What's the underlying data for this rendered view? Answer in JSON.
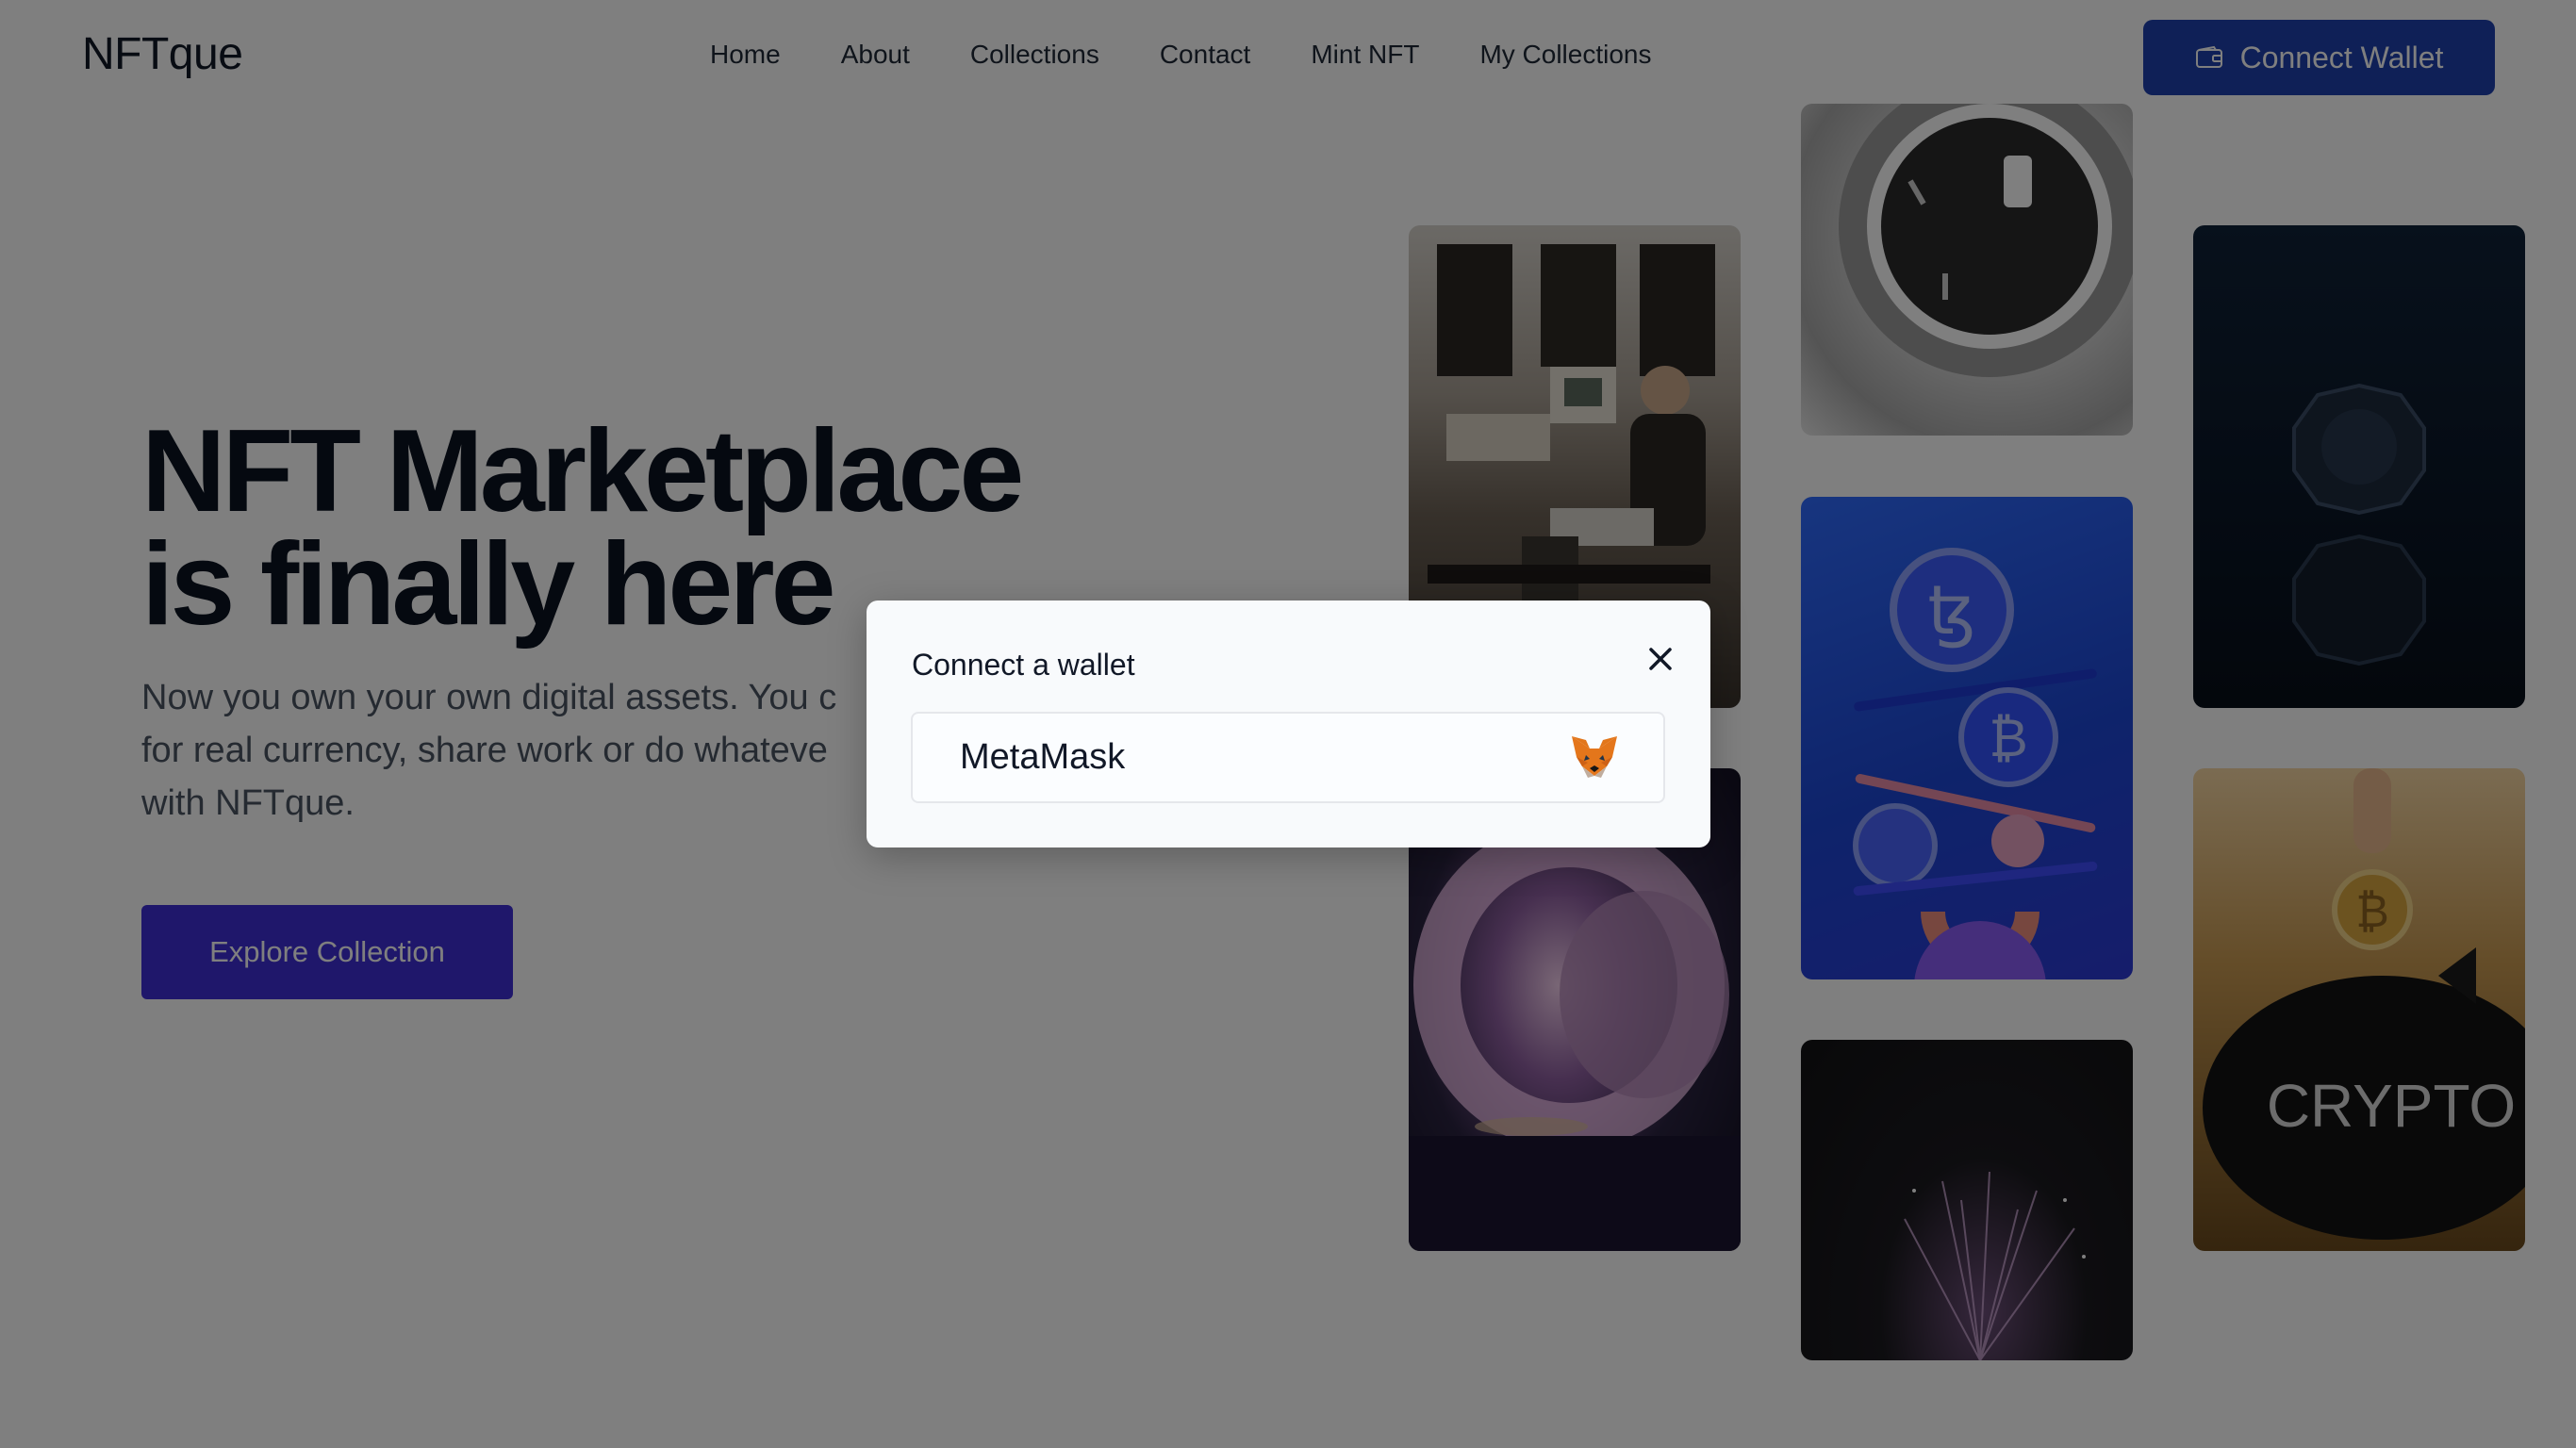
{
  "nav": {
    "brand": "NFTque",
    "links": [
      "Home",
      "About",
      "Collections",
      "Contact",
      "Mint NFT",
      "My Collections"
    ],
    "connect_label": "Connect Wallet"
  },
  "hero": {
    "title_line1": "NFT Marketplace",
    "title_line2": "is finally here",
    "desc_line1": "Now you own your own digital assets. You c",
    "desc_line2": "for real currency, share work or do whateve",
    "desc_line3": "with NFTque.",
    "explore_label": "Explore Collection"
  },
  "gallery": {
    "tiles": [
      "retro-computer-room",
      "glowing-ring-sculpture",
      "wristwatch",
      "crypto-coins-balance",
      "dark-sparkle-burst",
      "coin-reflection",
      "crypto-piggy-bank"
    ],
    "pig_text": "CRYPTO"
  },
  "modal": {
    "title": "Connect a wallet",
    "option_label": "MetaMask",
    "option_icon": "metamask-fox-icon",
    "close_icon": "close-icon"
  },
  "colors": {
    "primary_button": "#1e40af",
    "explore_button": "#3f2fd6",
    "overlay": "rgba(0,0,0,0.5)",
    "modal_bg": "#f8fafc"
  }
}
